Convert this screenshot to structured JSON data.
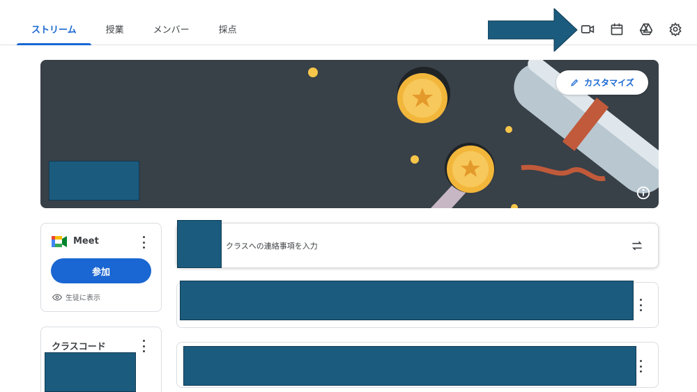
{
  "tabs": [
    {
      "label": "ストリーム",
      "active": true
    },
    {
      "label": "授業",
      "active": false
    },
    {
      "label": "メンバー",
      "active": false
    },
    {
      "label": "採点",
      "active": false
    }
  ],
  "toolbar_icons": [
    "video-camera-icon",
    "calendar-icon",
    "drive-icon",
    "settings-gear-icon"
  ],
  "banner": {
    "customize_label": "カスタマイズ",
    "icons": [
      "pencil-icon",
      "info-icon"
    ]
  },
  "meet": {
    "title": "Meet",
    "join_label": "参加",
    "visible_label": "生徒に表示"
  },
  "class_code": {
    "title": "クラスコード"
  },
  "announce": {
    "placeholder": "クラスへの連絡事項を入力"
  },
  "colors": {
    "accent": "#1967d2",
    "join_button": "#1a66d2",
    "banner_bg": "#384048",
    "redaction": "#1b5b7e"
  }
}
